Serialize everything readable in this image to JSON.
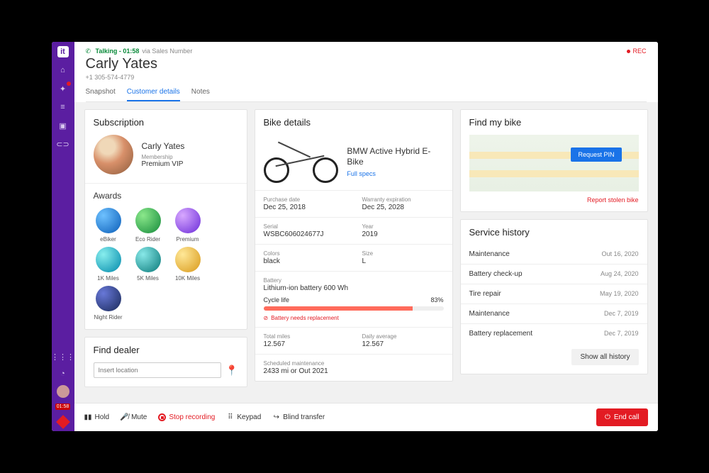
{
  "call": {
    "status": "Talking",
    "duration": "01:58",
    "via": "via Sales Number",
    "rec": "REC"
  },
  "customer": {
    "name": "Carly Yates",
    "phone": "+1 305-574-4779"
  },
  "tabs": [
    "Snapshot",
    "Customer details",
    "Notes"
  ],
  "subscription": {
    "title": "Subscription",
    "name": "Carly Yates",
    "membership_label": "Membership",
    "membership": "Premium VIP"
  },
  "awards": {
    "title": "Awards",
    "items": [
      "eBiker",
      "Eco Rider",
      "Premium",
      "1K Miles",
      "5K Miles",
      "10K Miles",
      "Night Rider"
    ]
  },
  "dealer": {
    "title": "Find dealer",
    "placeholder": "Insert location"
  },
  "bike": {
    "title": "Bike details",
    "name": "BMW Active Hybrid E-Bike",
    "fullspecs": "Full specs",
    "purchase_l": "Purchase date",
    "purchase": "Dec 25, 2018",
    "warranty_l": "Warranty expiration",
    "warranty": "Dec 25, 2028",
    "serial_l": "Serial",
    "serial": "WSBC606024677J",
    "year_l": "Year",
    "year": "2019",
    "colors_l": "Colors",
    "colors": "black",
    "size_l": "Size",
    "size": "L",
    "battery_l": "Battery",
    "battery": "Lithium-ion battery 600 Wh",
    "cycle_l": "Cycle life",
    "cycle_pct": "83%",
    "warn": "Battery needs replacement",
    "total_l": "Total miles",
    "total": "12.567",
    "daily_l": "Daily average",
    "daily": "12.567",
    "sched_l": "Scheduled maintenance",
    "sched": "2433 mi or Out 2021"
  },
  "findbike": {
    "title": "Find my bike",
    "button": "Request PIN",
    "report": "Report stolen bike"
  },
  "service": {
    "title": "Service history",
    "items": [
      {
        "name": "Maintenance",
        "date": "Out 16, 2020"
      },
      {
        "name": "Battery check-up",
        "date": "Aug 24, 2020"
      },
      {
        "name": "Tire repair",
        "date": "May 19, 2020"
      },
      {
        "name": "Maintenance",
        "date": "Dec 7, 2019"
      },
      {
        "name": "Battery replacement",
        "date": "Dec 7, 2019"
      }
    ],
    "showall": "Show all history"
  },
  "callbar": {
    "hold": "Hold",
    "mute": "Mute",
    "stoprec": "Stop recording",
    "keypad": "Keypad",
    "transfer": "Blind transfer",
    "end": "End call"
  },
  "sidebar_time": "01:58"
}
